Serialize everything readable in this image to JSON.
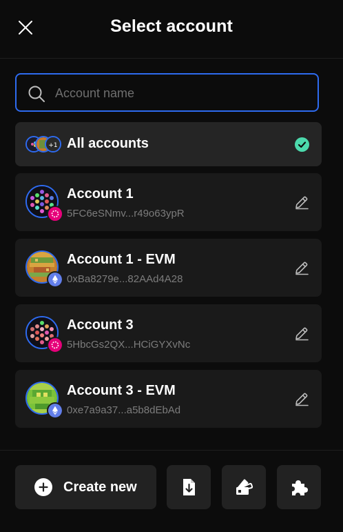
{
  "header": {
    "title": "Select account"
  },
  "search": {
    "placeholder": "Account name",
    "value": ""
  },
  "all_accounts": {
    "label": "All accounts",
    "selected": true
  },
  "accounts": [
    {
      "name": "Account 1",
      "address": "5FC6eSNmv...r49o63ypR",
      "network": "polkadot"
    },
    {
      "name": "Account 1 - EVM",
      "address": "0xBa8279e...82AAd4A28",
      "network": "ethereum"
    },
    {
      "name": "Account 3",
      "address": "5HbcGs2QX...HCiGYXvNc",
      "network": "polkadot"
    },
    {
      "name": "Account 3 - EVM",
      "address": "0xe7a9a37...a5b8dEbAd",
      "network": "ethereum"
    }
  ],
  "footer": {
    "create_label": "Create new",
    "icons": [
      "import-icon",
      "restore-icon",
      "extension-icon"
    ]
  },
  "colors": {
    "accent": "#2e6bf0",
    "success": "#4cd9ac",
    "polkadot": "#e6007a",
    "ethereum": "#627eea"
  }
}
